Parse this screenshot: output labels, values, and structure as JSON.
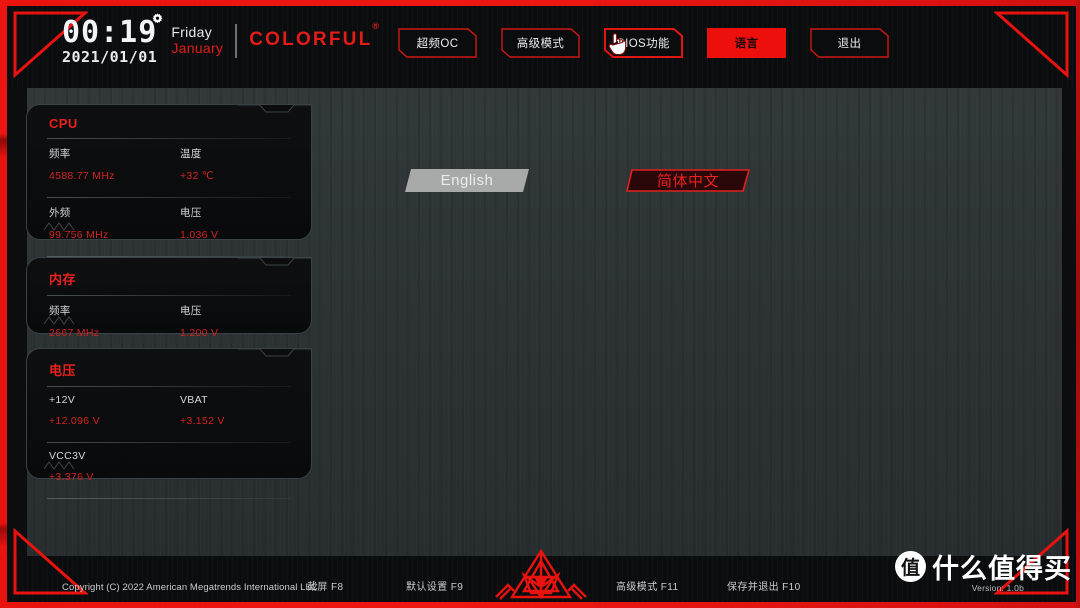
{
  "header": {
    "time": "00:19",
    "date": "2021/01/01",
    "weekday": "Friday",
    "month": "January",
    "brand": "COLORFUL",
    "brand_mark": "®",
    "gear_icon": "gear-icon"
  },
  "topnav": {
    "items": [
      {
        "label": "超频OC",
        "active": false
      },
      {
        "label": "高级模式",
        "active": false
      },
      {
        "label": "BIOS功能",
        "active": false,
        "cursor": "pointing-hand-cursor"
      },
      {
        "label": "语言",
        "active": true
      },
      {
        "label": "退出",
        "active": false
      }
    ]
  },
  "panels": [
    {
      "title": "CPU",
      "rows": [
        [
          {
            "label": "频率",
            "value": "4588.77 MHz"
          },
          {
            "label": "温度",
            "value": "+32 ℃"
          }
        ],
        [
          {
            "label": "外频",
            "value": "99.756 MHz"
          },
          {
            "label": "电压",
            "value": "1.036 V"
          }
        ]
      ]
    },
    {
      "title": "内存",
      "rows": [
        [
          {
            "label": "频率",
            "value": "2667 MHz"
          },
          {
            "label": "电压",
            "value": "1.200 V"
          }
        ]
      ]
    },
    {
      "title": "电压",
      "rows": [
        [
          {
            "label": "+12V",
            "value": "+12.096 V"
          },
          {
            "label": "VBAT",
            "value": "+3.152 V"
          }
        ],
        [
          {
            "label": "VCC3V",
            "value": "+3.376 V"
          }
        ]
      ]
    }
  ],
  "language": {
    "options": [
      {
        "label": "English",
        "state": "hover"
      },
      {
        "label": "简体中文",
        "state": "selected"
      }
    ]
  },
  "footer": {
    "copyright": "Copyright (C) 2022 American Megatrends International LLC",
    "hints": [
      {
        "label": "截屏 F8"
      },
      {
        "label": "默认设置 F9"
      },
      {
        "label": "高级模式 F11"
      },
      {
        "label": "保存并退出 F10"
      }
    ],
    "version": "Version: 1.0b",
    "emblem": "colorful-triangle-emblem"
  },
  "watermark": {
    "badge": "值",
    "text": "什么值得买"
  },
  "colors": {
    "accent_red": "#e9211d",
    "active_red": "#ec0f0c",
    "frame_red": "#e8120e",
    "background": "#2e3436",
    "panel_bg": "#0d0f11",
    "text_light": "#e9ecee"
  }
}
